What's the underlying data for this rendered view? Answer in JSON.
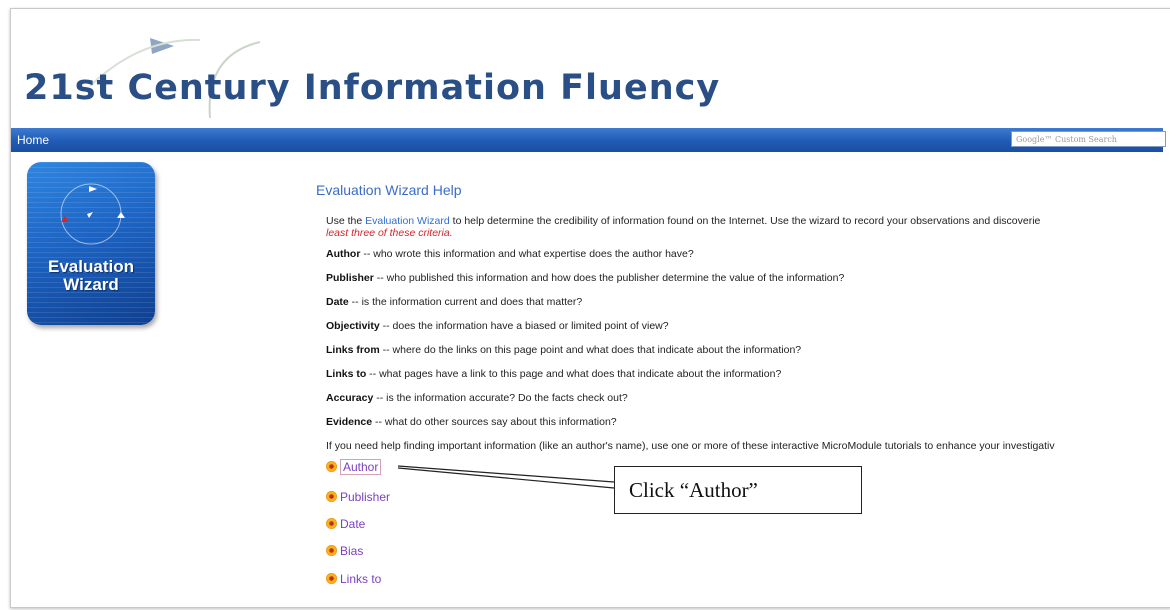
{
  "header": {
    "site_title": "21st Century Information Fluency"
  },
  "navbar": {
    "home_label": "Home",
    "search_placeholder": "Google™ Custom Search"
  },
  "logo": {
    "line1": "Evaluation",
    "line2": "Wizard"
  },
  "main": {
    "title": "Evaluation Wizard Help",
    "intro_before": "Use the ",
    "intro_link": "Evaluation Wizard",
    "intro_after": " to help determine the credibility of information found on the Internet. Use the wizard to record your observations and discoverie",
    "intro_note": "least three of these criteria.",
    "criteria": [
      {
        "term": "Author",
        "text": " -- who wrote this information and what expertise does the author have?"
      },
      {
        "term": "Publisher",
        "text": " -- who published this information and how does the publisher determine the value of the information?"
      },
      {
        "term": "Date",
        "text": " -- is the information current and does that matter?"
      },
      {
        "term": "Objectivity",
        "text": " -- does the information have a biased or limited point of view?"
      },
      {
        "term": "Links from",
        "text": " -- where do the links on this page point and what does that indicate about the information?"
      },
      {
        "term": "Links to",
        "text": " -- what pages have a link to this page and what does that indicate about the information?"
      },
      {
        "term": "Accuracy",
        "text": " -- is the information accurate? Do the facts check out?"
      },
      {
        "term": "Evidence",
        "text": " -- what do other sources say about this information?"
      }
    ],
    "help_text": "If you need help finding important information (like an author's name), use one or more of these interactive MicroModule tutorials to enhance your investigativ",
    "micromodules": [
      "Author",
      "Publisher",
      "Date",
      "Bias",
      "Links to"
    ]
  },
  "callout": {
    "text": "Click “Author”"
  },
  "colors": {
    "title_blue": "#2a4f86",
    "nav_blue": "#1f5bb5",
    "link_blue": "#2f6fd1",
    "module_purple": "#7a3fbf",
    "note_red": "#d2262b"
  }
}
